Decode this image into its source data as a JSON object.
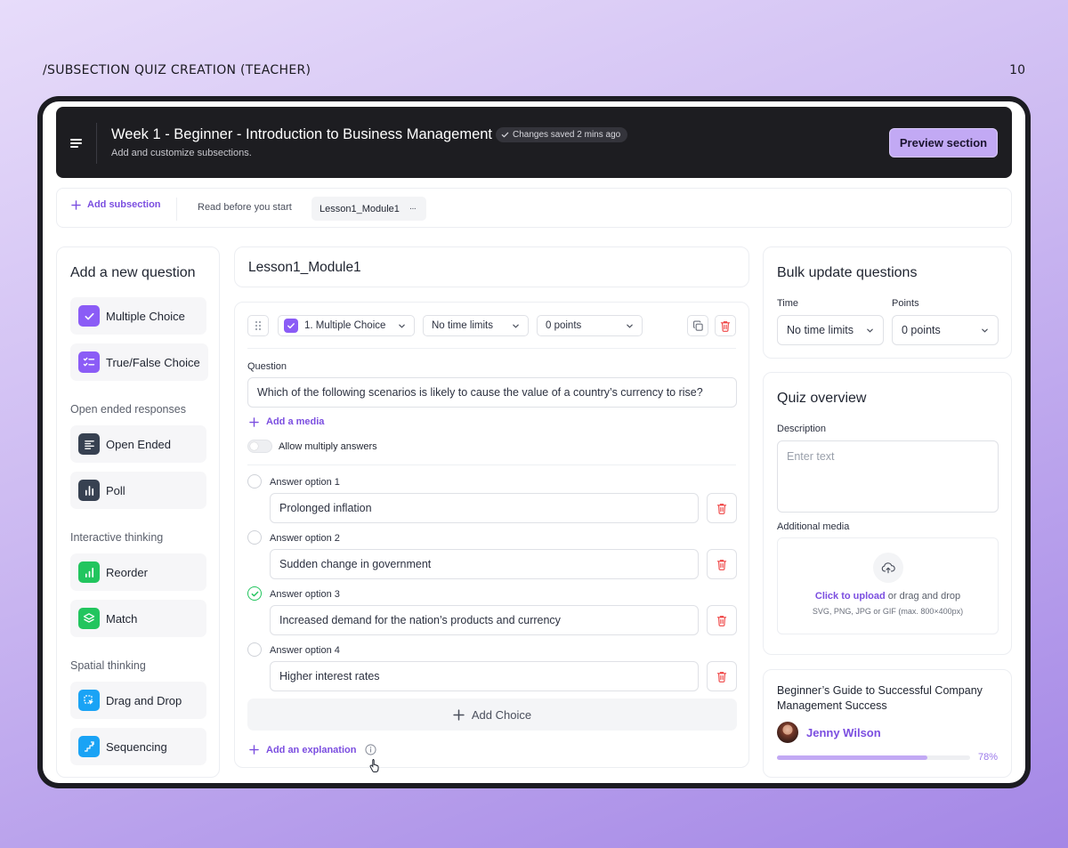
{
  "caption": "/SUBSECTION QUIZ CREATION (TEACHER)",
  "page_number": "10",
  "header": {
    "title": "Week 1 - Beginner - Introduction to Business Management",
    "saved_badge": "Changes saved 2 mins ago",
    "subtitle": "Add and customize subsections.",
    "preview_button": "Preview section"
  },
  "tabs": {
    "add_subsection": "Add subsection",
    "items": [
      "Read before you start",
      "Lesson1_Module1"
    ],
    "more": "···"
  },
  "sidebar": {
    "title": "Add a new question",
    "groups": [
      "Open ended responses",
      "Interactive thinking",
      "Spatial thinking"
    ],
    "types": [
      {
        "label": "Multiple Choice",
        "icon": "checkbox-icon",
        "color": "#8b5cf6"
      },
      {
        "label": "True/False Choice",
        "icon": "list-check-icon",
        "color": "#8b5cf6"
      },
      {
        "label": "Open Ended",
        "icon": "text-lines-icon",
        "color": "#374151"
      },
      {
        "label": "Poll",
        "icon": "bar-chart-icon",
        "color": "#374151"
      },
      {
        "label": "Reorder",
        "icon": "bar-chart-icon",
        "color": "#22c55e"
      },
      {
        "label": "Match",
        "icon": "layers-icon",
        "color": "#22c55e"
      },
      {
        "label": "Drag and Drop",
        "icon": "drag-drop-icon",
        "color": "#1aa3f5"
      },
      {
        "label": "Sequencing",
        "icon": "stairs-icon",
        "color": "#1aa3f5"
      }
    ]
  },
  "editor": {
    "title": "Lesson1_Module1",
    "question_type": "1. Multiple Choice",
    "time_limit": "No time limits",
    "points": "0 points",
    "question_label": "Question",
    "question_text": "Which of the following scenarios is likely to cause the value of a country’s currency to rise?",
    "add_media": "Add a media",
    "allow_multiple": "Allow multiply answers",
    "options": [
      {
        "label": "Answer option 1",
        "value": "Prolonged inflation",
        "correct": false
      },
      {
        "label": "Answer option 2",
        "value": "Sudden change in government",
        "correct": false
      },
      {
        "label": "Answer option 3",
        "value": "Increased demand for the nation’s products and currency",
        "correct": true
      },
      {
        "label": "Answer option 4",
        "value": "Higher interest rates",
        "correct": false
      }
    ],
    "add_choice": "Add Choice",
    "add_explanation": "Add an explanation"
  },
  "bulk": {
    "title": "Bulk update questions",
    "time_label": "Time",
    "time_value": "No time limits",
    "points_label": "Points",
    "points_value": "0 points"
  },
  "overview": {
    "title": "Quiz overview",
    "description_label": "Description",
    "description_placeholder": "Enter text",
    "media_label": "Additional media",
    "upload_link": "Click to upload",
    "upload_rest": "or drag and drop",
    "upload_hint": "SVG, PNG, JPG or GIF (max. 800×400px)"
  },
  "course": {
    "title": "Beginner’s Guide to Successful Company Management Success",
    "author": "Jenny Wilson",
    "progress_value": 0.78,
    "progress_text": "78%"
  },
  "colors": {
    "accent": "#7b4ee0",
    "accent_light": "#c2a9f4",
    "danger": "#ef4444",
    "success": "#22c55e"
  }
}
